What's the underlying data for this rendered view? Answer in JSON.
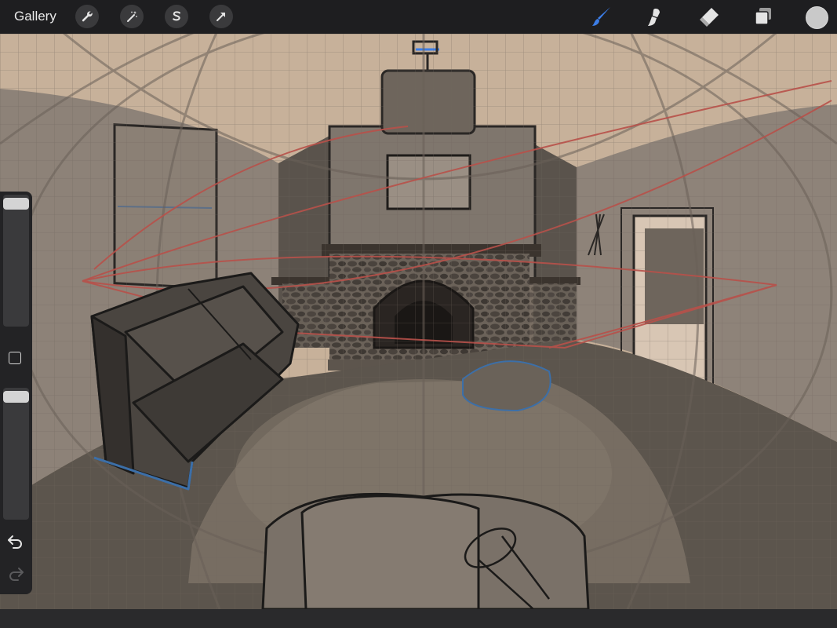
{
  "toolbar": {
    "gallery_label": "Gallery",
    "left_tools": [
      {
        "icon": "wrench-icon",
        "name": "actions"
      },
      {
        "icon": "magic-wand-icon",
        "name": "adjustments"
      },
      {
        "icon": "selection-s-icon",
        "name": "selection"
      },
      {
        "icon": "arrow-cursor-icon",
        "name": "transform"
      }
    ],
    "right_tools": [
      {
        "icon": "brush-icon",
        "name": "brush",
        "active": true
      },
      {
        "icon": "smudge-icon",
        "name": "smudge"
      },
      {
        "icon": "eraser-icon",
        "name": "eraser"
      },
      {
        "icon": "layers-icon",
        "name": "layers"
      }
    ],
    "accent_color": "#3c7de6",
    "current_color": "#c9c9c9"
  },
  "sidebar": {
    "brush_size_icon": "size-slider",
    "opacity_icon": "opacity-slider",
    "modify_icon": "square-modify-icon",
    "undo_icon": "undo-icon",
    "redo_icon": "redo-icon"
  },
  "canvas": {
    "description_colors": {
      "background": "#c7b19a",
      "wall": "#8a7f73",
      "floor": "#5c554d",
      "sketch_line": "#2a2725",
      "guide_red": "#b8514a",
      "grid": "#7f7468"
    }
  }
}
